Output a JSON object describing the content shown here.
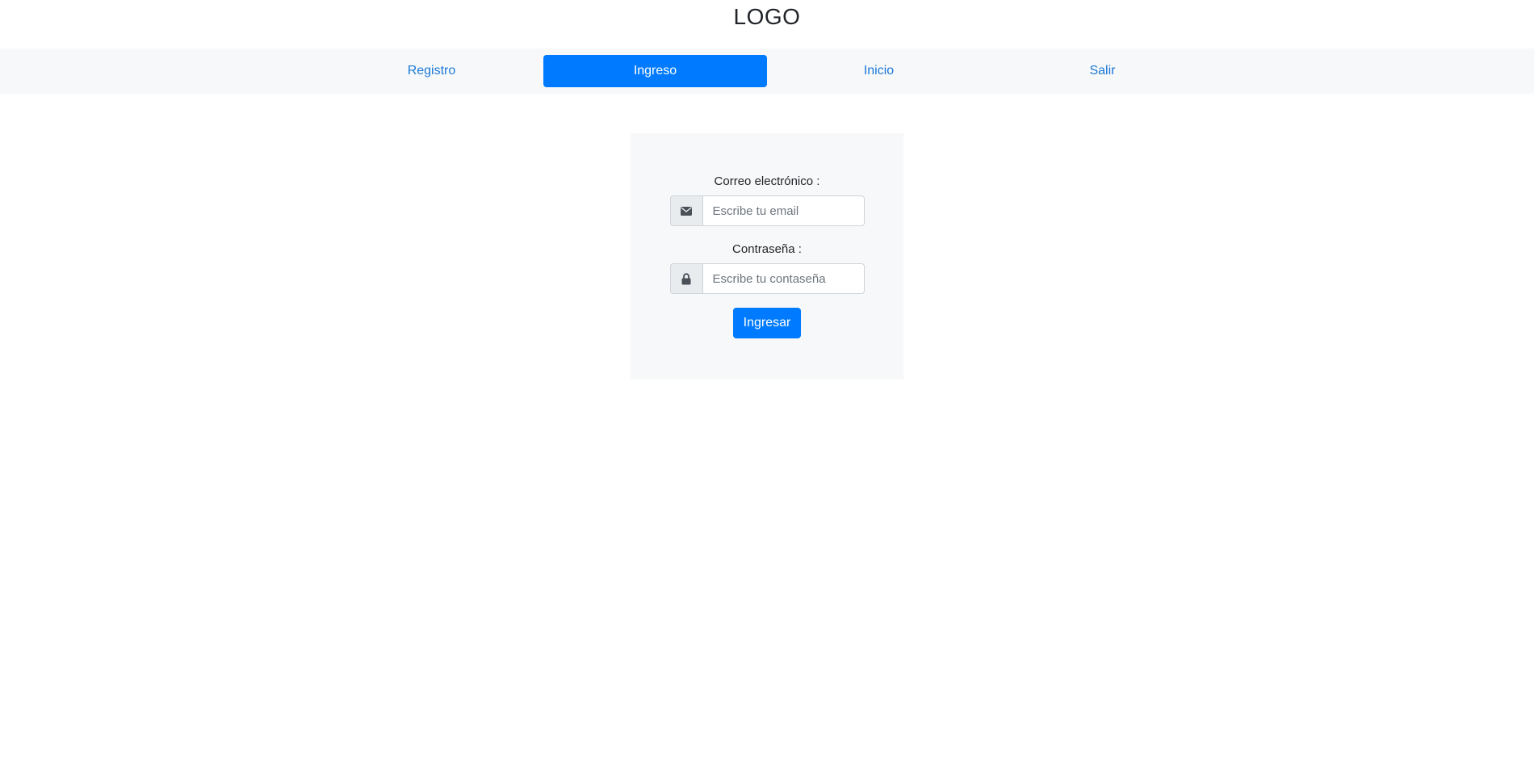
{
  "header": {
    "logo": "LOGO"
  },
  "nav": {
    "items": [
      {
        "label": "Registro"
      },
      {
        "label": "Ingreso",
        "active": true
      },
      {
        "label": "Inicio"
      },
      {
        "label": "Salir"
      }
    ]
  },
  "login": {
    "email_label": "Correo electrónico :",
    "email_placeholder": "Escribe tu email",
    "email_value": "",
    "email_icon": "envelope-icon",
    "password_label": "Contraseña :",
    "password_placeholder": "Escribe tu contaseña",
    "password_value": "",
    "password_icon": "lock-icon",
    "submit_label": "Ingresar"
  },
  "colors": {
    "primary": "#007bff",
    "link": "#1a79d8",
    "panel_bg": "#f7f8f9",
    "addon_bg": "#e9ecef",
    "text": "#212529"
  }
}
